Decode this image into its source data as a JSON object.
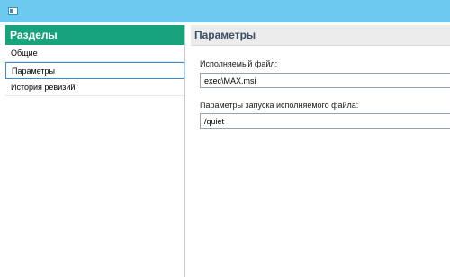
{
  "sidebar": {
    "title": "Разделы",
    "items": [
      {
        "label": "Общие"
      },
      {
        "label": "Параметры"
      },
      {
        "label": "История ревизий"
      }
    ]
  },
  "main": {
    "title": "Параметры",
    "executable": {
      "label": "Исполняемый файл:",
      "value": "exec\\MAX.msi"
    },
    "launch_params": {
      "label": "Параметры запуска исполняемого файла:",
      "value": "/quiet"
    }
  }
}
